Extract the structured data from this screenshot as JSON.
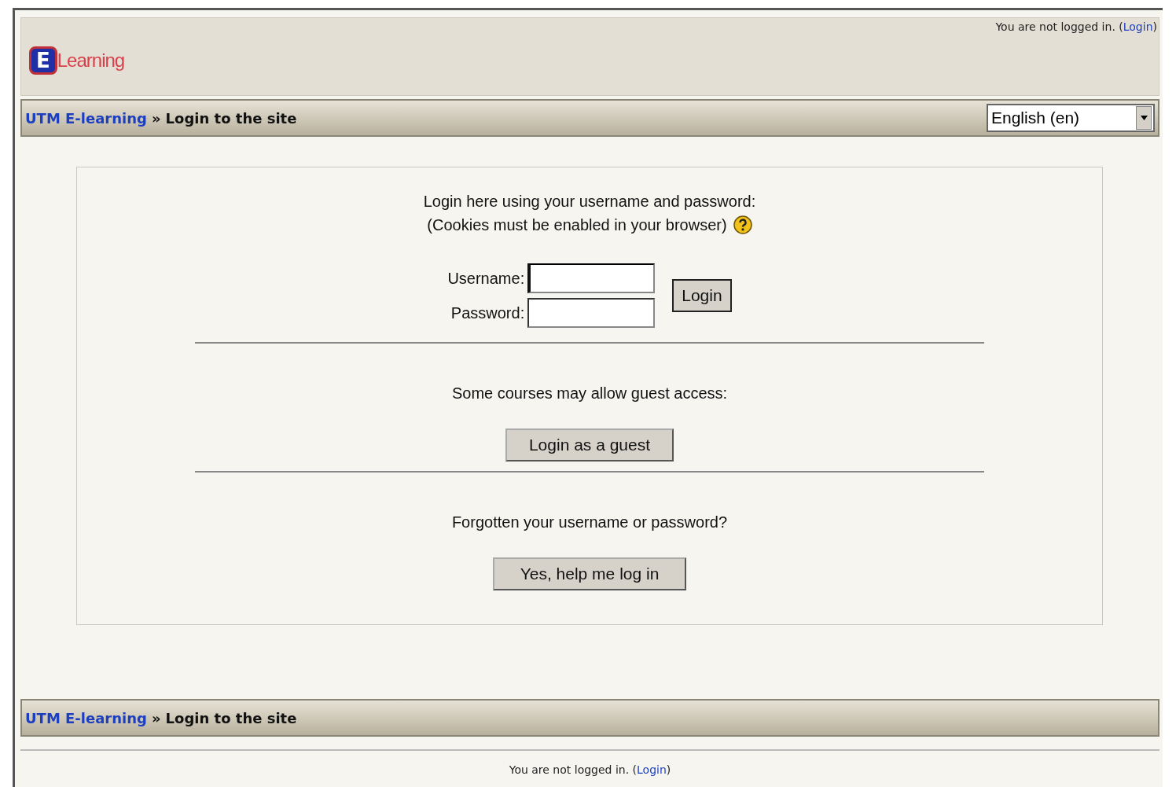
{
  "header": {
    "logo": {
      "mark": "E",
      "word": "Learning"
    },
    "login_status": {
      "text": "You are not logged in. (",
      "link": "Login",
      "after": ")"
    }
  },
  "navbar": {
    "home": "UTM E-learning",
    "separator": "»",
    "current": "Login to the site",
    "language": "English (en)"
  },
  "login_box": {
    "intro": "Login here using your username and password:",
    "cookies_note": "(Cookies must be enabled in your browser)",
    "fields": [
      {
        "label": "Username:",
        "focused": true
      },
      {
        "label": "Password:",
        "focused": false
      }
    ],
    "login_button": "Login",
    "guest_text": "Some courses may allow guest access:",
    "guest_button": "Login as a guest",
    "forgot_text": "Forgotten your username or password?",
    "forgot_button": "Yes, help me log in"
  },
  "footer_navbar": {
    "home": "UTM E-learning",
    "separator": "»",
    "current": "Login to the site"
  },
  "footer": {
    "text": "You are not logged in. (",
    "link": "Login",
    "after": ")"
  }
}
